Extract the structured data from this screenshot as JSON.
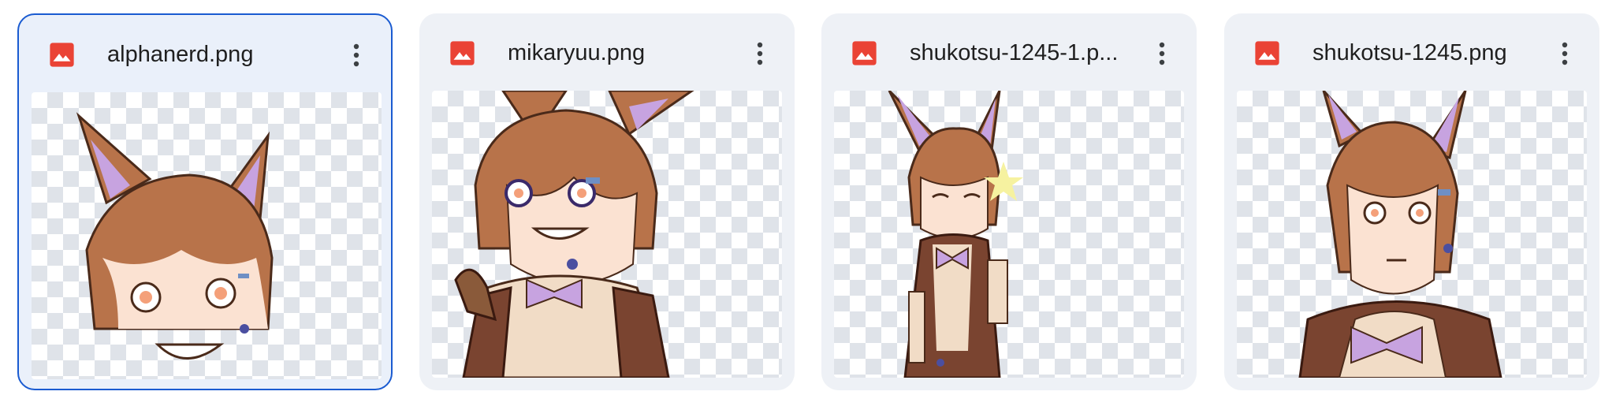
{
  "files": [
    {
      "name": "alphanerd.png",
      "icon": "image-file-icon",
      "selected": true
    },
    {
      "name": "mikaryuu.png",
      "icon": "image-file-icon",
      "selected": false
    },
    {
      "name": "shukotsu-1245-1.p...",
      "icon": "image-file-icon",
      "selected": false
    },
    {
      "name": "shukotsu-1245.png",
      "icon": "image-file-icon",
      "selected": false
    }
  ],
  "colors": {
    "icon_red": "#ea4335",
    "selected_border": "#1a5bd1",
    "card_bg": "#eef1f6",
    "hair": "#b8734a",
    "ear_inner": "#c7a3e0",
    "skin": "#fbe2d2"
  }
}
